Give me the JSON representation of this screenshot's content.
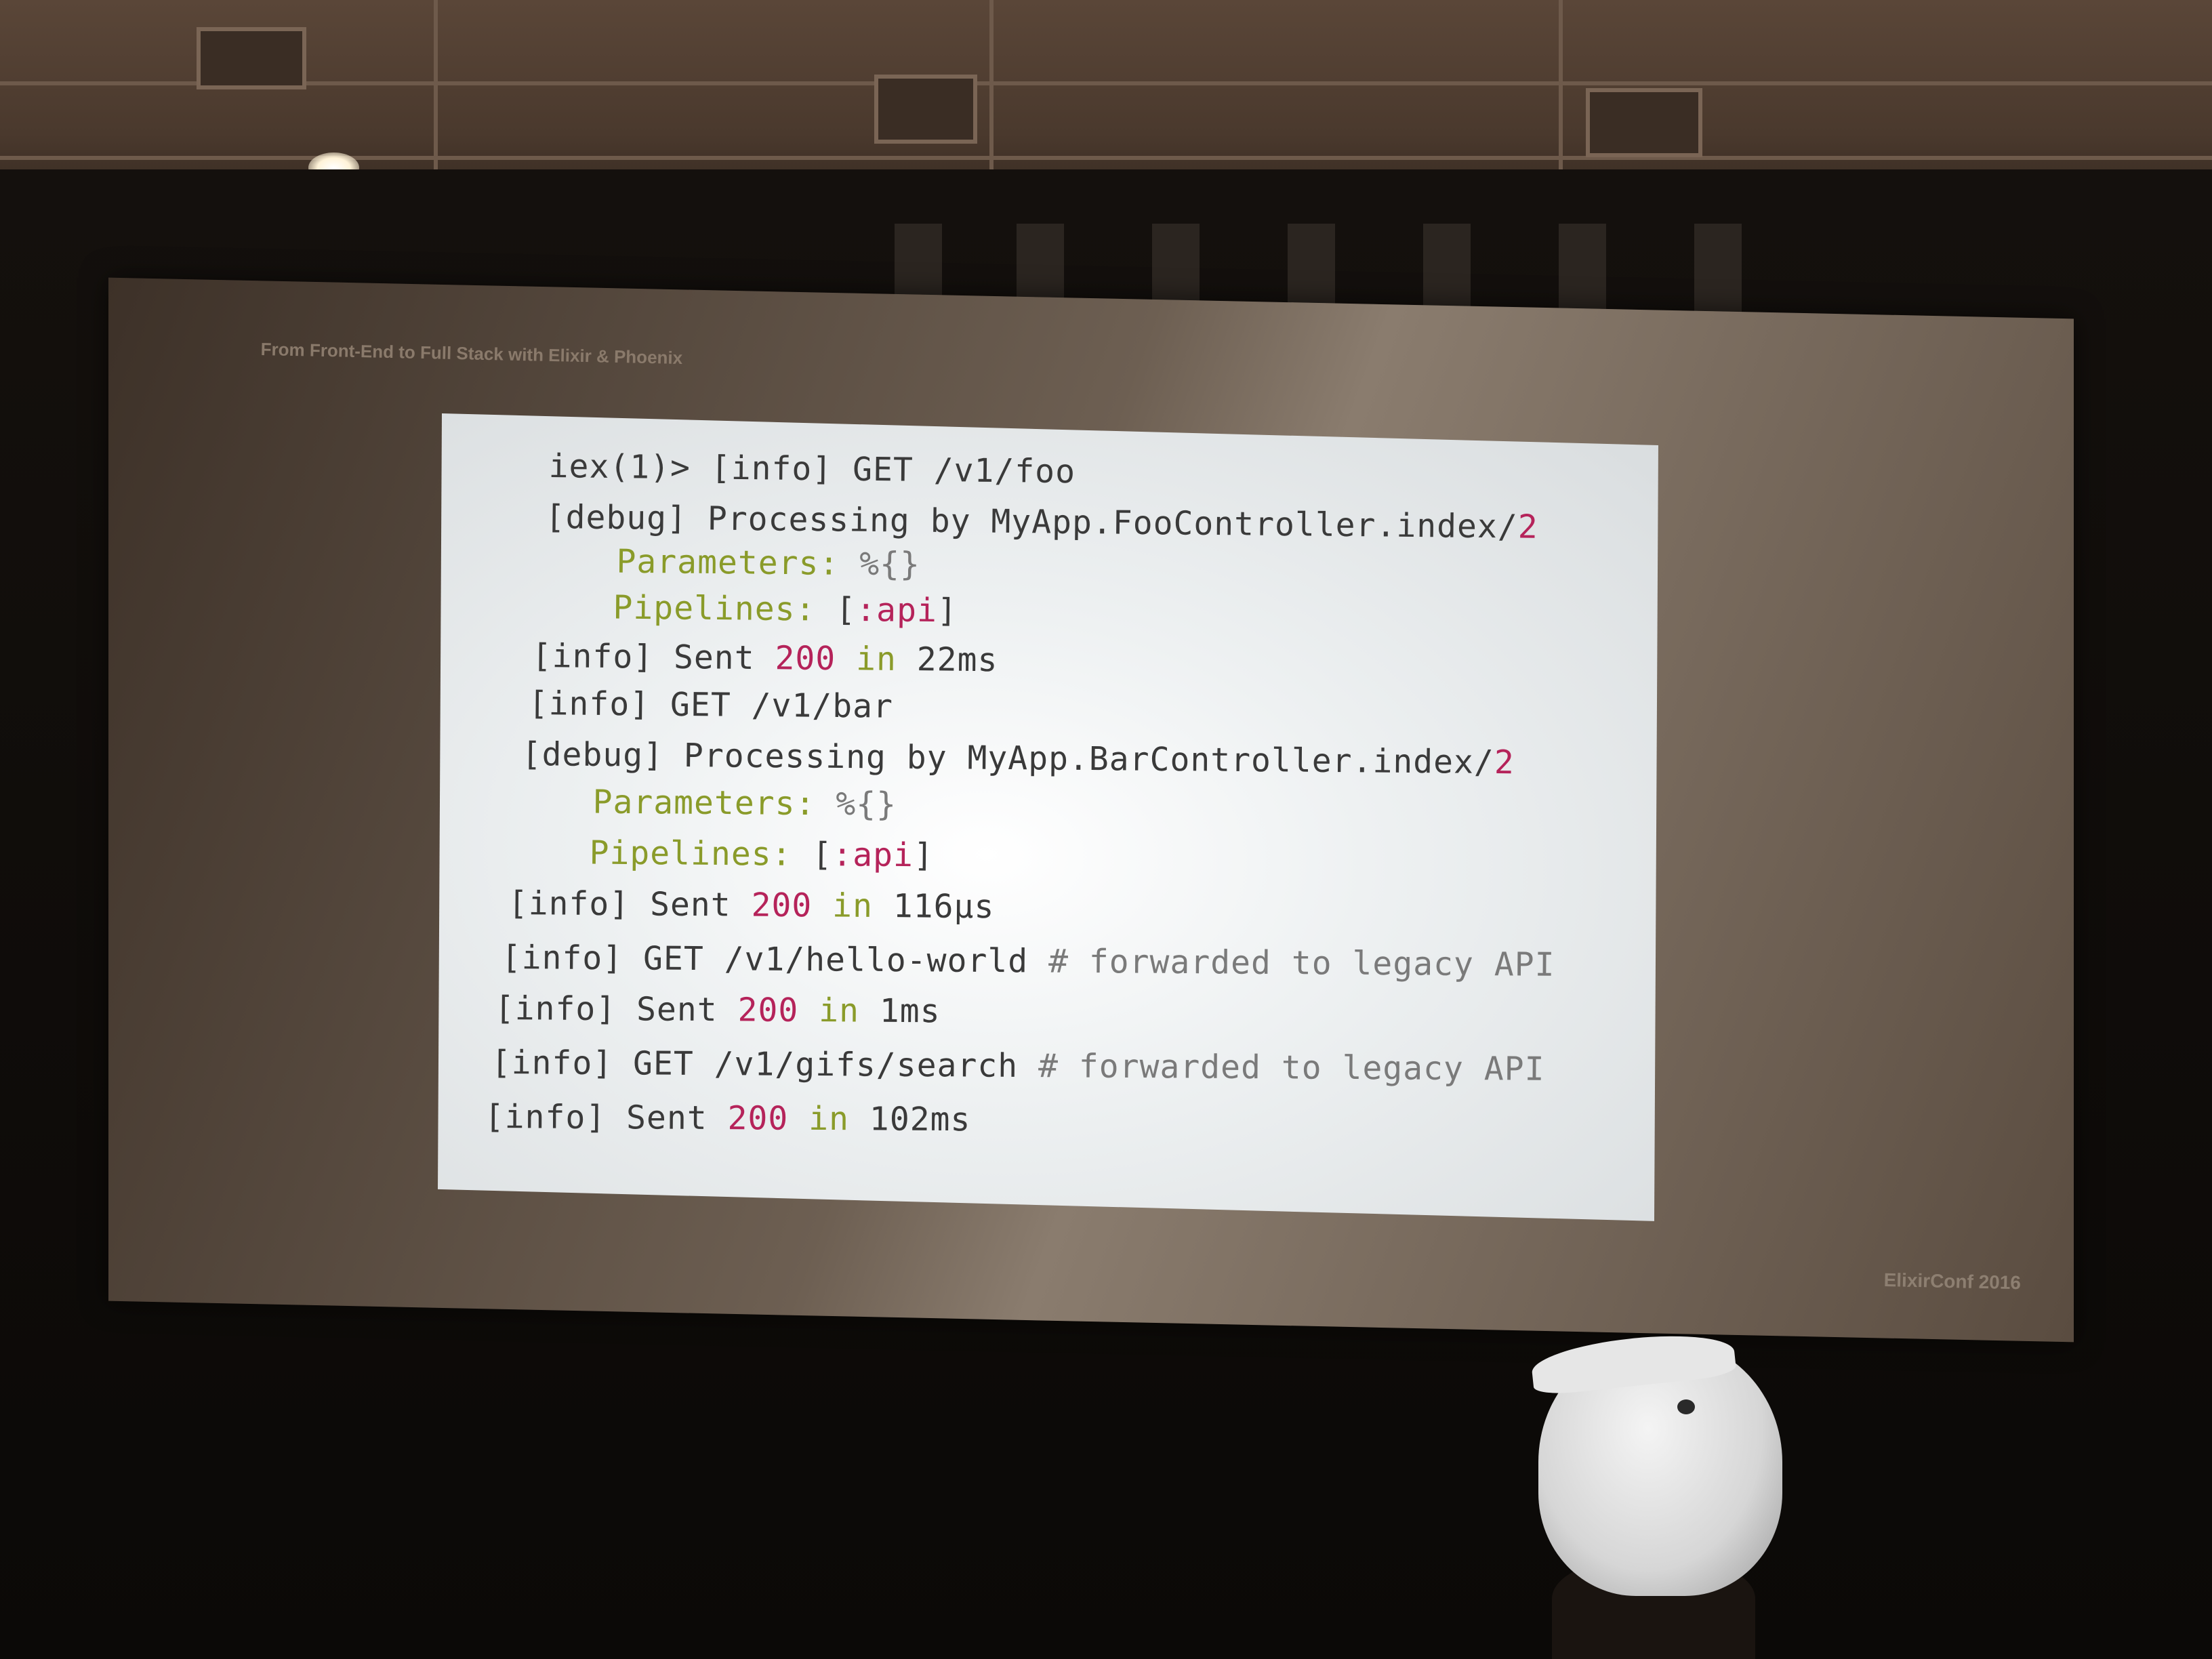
{
  "slide": {
    "header": "From Front-End to Full Stack with Elixir & Phoenix",
    "footer": "ElixirConf 2016"
  },
  "code_lines": [
    {
      "segments": [
        {
          "text": "iex(1)> [info] GET /v1/foo",
          "style": "plain"
        }
      ]
    },
    {
      "segments": [
        {
          "text": "[debug] Processing by MyApp.FooController.index/",
          "style": "plain"
        },
        {
          "text": "2",
          "style": "red"
        }
      ]
    },
    {
      "segments": [
        {
          "text": "  Parameters: ",
          "style": "green"
        },
        {
          "text": "%{}",
          "style": "grey"
        }
      ]
    },
    {
      "segments": [
        {
          "text": "  Pipelines: ",
          "style": "green"
        },
        {
          "text": "[",
          "style": "plain"
        },
        {
          "text": ":api",
          "style": "red"
        },
        {
          "text": "]",
          "style": "plain"
        }
      ]
    },
    {
      "segments": [
        {
          "text": "[info] Sent ",
          "style": "plain"
        },
        {
          "text": "200",
          "style": "red"
        },
        {
          "text": " in ",
          "style": "green"
        },
        {
          "text": "22ms",
          "style": "plain"
        }
      ]
    },
    {
      "segments": [
        {
          "text": "[info] GET /v1/bar",
          "style": "plain"
        }
      ]
    },
    {
      "segments": [
        {
          "text": "[debug] Processing by MyApp.BarController.index/",
          "style": "plain"
        },
        {
          "text": "2",
          "style": "red"
        }
      ]
    },
    {
      "segments": [
        {
          "text": "  Parameters: ",
          "style": "green"
        },
        {
          "text": "%{}",
          "style": "grey"
        }
      ]
    },
    {
      "segments": [
        {
          "text": "  Pipelines: ",
          "style": "green"
        },
        {
          "text": "[",
          "style": "plain"
        },
        {
          "text": ":api",
          "style": "red"
        },
        {
          "text": "]",
          "style": "plain"
        }
      ]
    },
    {
      "segments": [
        {
          "text": "[info] Sent ",
          "style": "plain"
        },
        {
          "text": "200",
          "style": "red"
        },
        {
          "text": " in ",
          "style": "green"
        },
        {
          "text": "116µs",
          "style": "plain"
        }
      ]
    },
    {
      "segments": [
        {
          "text": "[info] GET /v1/hello-world ",
          "style": "plain"
        },
        {
          "text": "# forwarded to legacy API",
          "style": "grey"
        }
      ]
    },
    {
      "segments": [
        {
          "text": "[info] Sent ",
          "style": "plain"
        },
        {
          "text": "200",
          "style": "red"
        },
        {
          "text": " in ",
          "style": "green"
        },
        {
          "text": "1ms",
          "style": "plain"
        }
      ]
    },
    {
      "segments": [
        {
          "text": "[info] GET /v1/gifs/search ",
          "style": "plain"
        },
        {
          "text": "# forwarded to legacy API",
          "style": "grey"
        }
      ]
    },
    {
      "segments": [
        {
          "text": "[info] Sent ",
          "style": "plain"
        },
        {
          "text": "200",
          "style": "red"
        },
        {
          "text": " in ",
          "style": "green"
        },
        {
          "text": "102ms",
          "style": "plain"
        }
      ]
    }
  ]
}
